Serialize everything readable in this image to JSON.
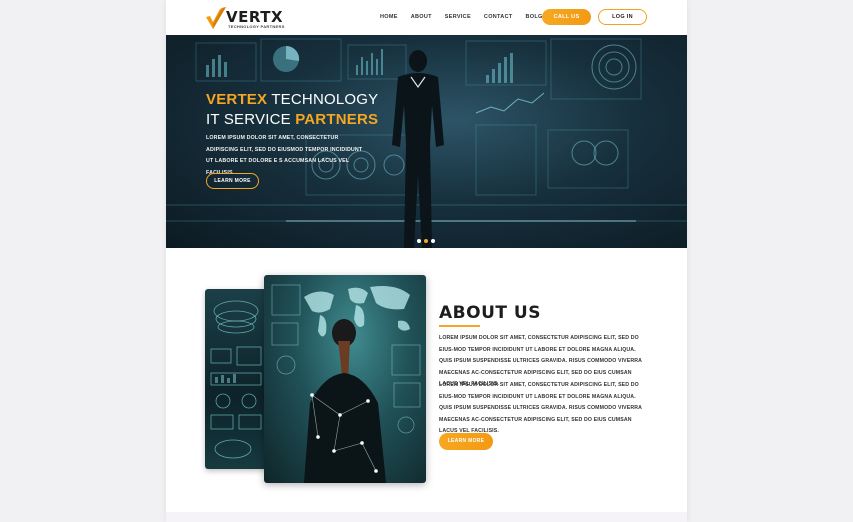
{
  "brand": {
    "name": "VERTX",
    "tagline": "TECHNOLOGY PARTNERS",
    "accent_color": "#f5a623"
  },
  "nav": {
    "items": [
      "HOME",
      "ABOUT",
      "SERVICE",
      "CONTACT",
      "BOLG"
    ],
    "call_label": "CALL US",
    "login_label": "LOG IN"
  },
  "hero": {
    "title_line1_accent": "VERTEX",
    "title_line1_rest": " TECHNOLOGY",
    "title_line2_rest": "IT SERVICE ",
    "title_line2_accent": "PARTNERS",
    "text": "LOREM IPSUM DOLOR SIT AMET, CONSECTETUR ADIPISCING ELIT, SED DO EIUSMOD TEMPOR INCIDIDUNT UT LABORE ET DOLORE E S ACCUMSAN LACUS VEL FACILISIS.",
    "button_label": "LEARN MORE",
    "slides": 3,
    "active_slide": 2
  },
  "about": {
    "title": "ABOUT US",
    "paragraph1": "LOREM IPSUM DOLOR SIT AMET, CONSECTETUR ADIPISCING ELIT, SED DO EIUS-MOD TEMPOR INCIDIDUNT UT LABORE ET DOLORE MAGNA ALIQUA. QUIS IPSUM SUSPENDISSE ULTRICES GRAVIDA. RISUS COMMODO VIVERRA MAECENAS AC-CONSECTETUR ADIPISCING ELIT, SED DO EIUS CUMSAN LACUS VEL FACILISIS.",
    "paragraph2": "LOREM IPSUM DOLOR SIT AMET, CONSECTETUR ADIPISCING ELIT, SED DO EIUS-MOD TEMPOR INCIDIDUNT UT LABORE ET DOLORE MAGNA ALIQUA. QUIS IPSUM SUSPENDISSE ULTRICES GRAVIDA. RISUS COMMODO VIVERRA MAECENAS AC-CONSECTETUR ADIPISCING ELIT, SED DO EIUS CUMSAN LACUS VEL FACILISIS.",
    "button_label": "LEARN MORE"
  }
}
